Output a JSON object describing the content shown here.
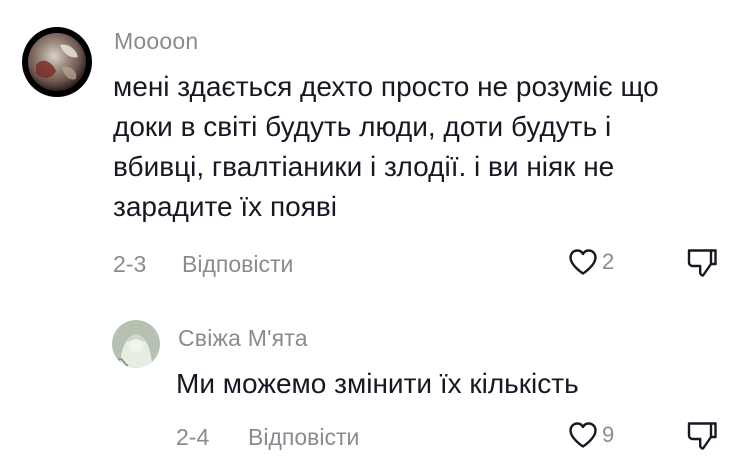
{
  "comments": [
    {
      "author": "Moooon",
      "text_lines": [
        "мені здається дехто просто не розуміє що",
        "доки в світі будуть люди, доти будуть і",
        "вбивці, гвалтіаники і злодії. і ви ніяк не",
        "зарадите їх появі"
      ],
      "date": "2-3",
      "reply_label": "Відповісти",
      "likes": "2",
      "avatar_icon": "planet-avatar"
    },
    {
      "author": "Свіжа М'ята",
      "text_lines": [
        "Ми можемо змінити їх кількість"
      ],
      "date": "2-4",
      "reply_label": "Відповісти",
      "likes": "9",
      "avatar_icon": "character-avatar"
    }
  ],
  "icons": {
    "like": "heart-icon",
    "dislike": "thumbs-down-icon"
  },
  "colors": {
    "text": "#161823",
    "secondary": "#8a8b91"
  }
}
